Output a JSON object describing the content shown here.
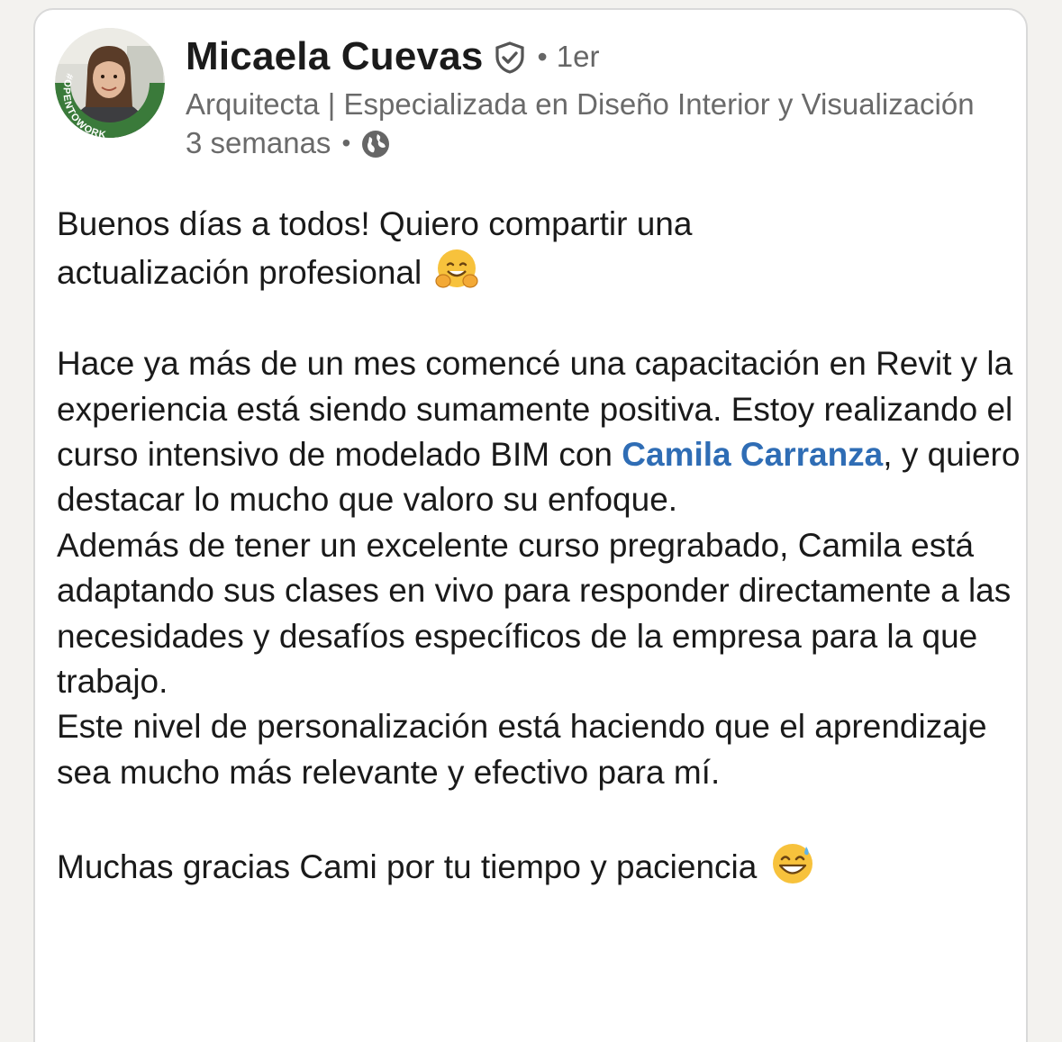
{
  "author": {
    "name": "Micaela Cuevas",
    "degree": "1er",
    "headline": "Arquitecta | Especializada en Diseño Interior y Visualización",
    "time": "3 semanas",
    "avatar_badge": "#OPENTOWORK"
  },
  "post": {
    "line1": "Buenos días a todos! Quiero compartir una",
    "line2": "actualización profesional",
    "p2_part1": "Hace ya más de un mes comencé una capacitación en Revit y la experiencia está siendo sumamente positiva. Estoy realizando el curso intensivo de modelado BIM con ",
    "mention": "Camila Carranza",
    "p2_part2": ", y quiero destacar lo mucho que valoro su enfoque.",
    "p3": "Además de tener un excelente curso pregrabado, Camila está adaptando sus clases en vivo para responder directamente a las necesidades y desafíos específicos de la empresa para la que trabajo.",
    "p4": "Este nivel de personalización está haciendo que el aprendizaje sea mucho más relevante y efectivo para mí.",
    "p5": "Muchas gracias Cami por tu tiempo y paciencia"
  },
  "icons": {
    "verified": "shield-check-icon",
    "visibility": "globe-icon",
    "emoji1": "hugging-face-emoji",
    "emoji2": "grinning-sweat-emoji"
  },
  "colors": {
    "mention": "#2f6db5",
    "open_to_work": "#3a7a3a",
    "secondary_text": "#6a6a6a"
  }
}
